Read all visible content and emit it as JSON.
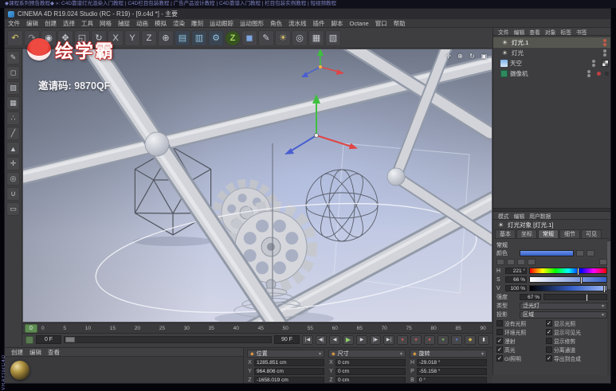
{
  "video": {
    "header": "◆课程系列预告教程◆ »: C4D靠谱灯光渲染入门教程 | C4D栏目包装教程 | 广告产品设计教程 | C4D靠谱入门教程 | 栏目包装实例教程 | 短视频教程"
  },
  "window": {
    "title": "CINEMA 4D R19.024 Studio (RC - R19) - [9.c4d *] - 主要"
  },
  "watermark": {
    "logo": "绘学霸",
    "invite": "邀请码: 9870QF"
  },
  "menubar": {
    "items": [
      "文件",
      "编辑",
      "创建",
      "选择",
      "工具",
      "网格",
      "捕捉",
      "动画",
      "模拟",
      "渲染",
      "雕刻",
      "运动跟踪",
      "运动图形",
      "角色",
      "流水线",
      "插件",
      "脚本",
      "Octane",
      "窗口",
      "帮助"
    ]
  },
  "toolbar": {
    "icons": [
      {
        "name": "undo-icon",
        "glyph": "↶"
      },
      {
        "name": "redo-icon",
        "glyph": "↷"
      },
      {
        "name": "live-selection-icon",
        "glyph": "◉"
      },
      {
        "name": "move-icon",
        "glyph": "✥"
      },
      {
        "name": "scale-icon",
        "glyph": "◱"
      },
      {
        "name": "rotate-icon",
        "glyph": "↻"
      },
      {
        "name": "x-lock-icon",
        "glyph": "X"
      },
      {
        "name": "y-lock-icon",
        "glyph": "Y"
      },
      {
        "name": "z-lock-icon",
        "glyph": "Z"
      },
      {
        "name": "coordinate-system-icon",
        "glyph": "⊕"
      },
      {
        "name": "render-view-icon",
        "glyph": "▤"
      },
      {
        "name": "render-picture-viewer-icon",
        "glyph": "▥"
      },
      {
        "name": "render-settings-icon",
        "glyph": "⚙"
      },
      {
        "name": "zdepth-plugin-icon",
        "glyph": "Z"
      },
      {
        "name": "add-cube-icon",
        "glyph": "◼"
      },
      {
        "name": "spline-pen-icon",
        "glyph": "✎"
      },
      {
        "name": "add-light-icon",
        "glyph": "☀"
      },
      {
        "name": "add-camera-icon",
        "glyph": "◎"
      },
      {
        "name": "display-mode-icon",
        "glyph": "▦"
      },
      {
        "name": "layout-icon",
        "glyph": "▧"
      }
    ]
  },
  "left_toolbar": {
    "icons": [
      {
        "name": "make-editable-icon",
        "glyph": "✎"
      },
      {
        "name": "model-mode-icon",
        "glyph": "◻"
      },
      {
        "name": "texture-mode-icon",
        "glyph": "▨"
      },
      {
        "name": "workplane-mode-icon",
        "glyph": "▦"
      },
      {
        "name": "points-mode-icon",
        "glyph": "∴"
      },
      {
        "name": "edges-mode-icon",
        "glyph": "╱"
      },
      {
        "name": "polygons-mode-icon",
        "glyph": "▲"
      },
      {
        "name": "enable-axis-icon",
        "glyph": "✛"
      },
      {
        "name": "viewport-solo-icon",
        "glyph": "◎"
      },
      {
        "name": "enable-snap-icon",
        "glyph": "∪"
      },
      {
        "name": "workplane-lock-icon",
        "glyph": "▭"
      }
    ]
  },
  "viewport": {
    "icons": [
      {
        "name": "pan-view-icon",
        "glyph": "✛"
      },
      {
        "name": "zoom-view-icon",
        "glyph": "⊕"
      },
      {
        "name": "orbit-view-icon",
        "glyph": "↻"
      },
      {
        "name": "toggle-view-icon",
        "glyph": "▣"
      }
    ]
  },
  "objects": {
    "menus": [
      "文件",
      "编辑",
      "查看",
      "对象",
      "标签",
      "书签"
    ],
    "items": [
      {
        "label": "灯光.1",
        "glyph": "☀"
      },
      {
        "label": "灯光",
        "glyph": "☀"
      },
      {
        "label": "天空",
        "glyph": ""
      },
      {
        "label": "摄像机",
        "glyph": ""
      }
    ]
  },
  "attributes": {
    "menus": [
      "模式",
      "编辑",
      "用户数据"
    ],
    "title_glyph": "☀",
    "title": "灯光对象 [灯光.1]",
    "tabs": [
      "基本",
      "坐标",
      "常规",
      "细节",
      "可见"
    ],
    "section": "常规",
    "color_label": "颜色",
    "color_hex": "#3f6fd8",
    "hsv": {
      "h_label": "H",
      "h": "221 °",
      "s_label": "S",
      "s": "66 %",
      "v_label": "V",
      "v": "100 %"
    },
    "intensity_label": "强度",
    "intensity": "67 %",
    "type_label": "类型",
    "type_value": "泛光灯",
    "shadow_label": "投影",
    "shadow_value": "区域",
    "checks": [
      {
        "left": "没有光照",
        "left_mark": "",
        "right": "显示光照",
        "right_mark": "✓"
      },
      {
        "left": "环境光照",
        "left_mark": "",
        "right": "显示可见光",
        "right_mark": "✓"
      },
      {
        "left": "漫射",
        "left_mark": "✓",
        "right": "显示修剪",
        "right_mark": ""
      },
      {
        "left": "高光",
        "left_mark": "✓",
        "right": "分离通道",
        "right_mark": ""
      },
      {
        "left": "GI照明",
        "left_mark": "✓",
        "right": "导出到合成",
        "right_mark": "✓"
      }
    ]
  },
  "timeline": {
    "current": "0",
    "ticks": [
      "0",
      "5",
      "10",
      "15",
      "20",
      "25",
      "30",
      "35",
      "40",
      "45",
      "50",
      "55",
      "60",
      "65",
      "70",
      "75",
      "80",
      "85",
      "90"
    ]
  },
  "transport": {
    "start": "0 F",
    "end": "90 F",
    "buttons": [
      {
        "name": "goto-start-icon",
        "glyph": "|◀"
      },
      {
        "name": "prev-key-icon",
        "glyph": "◀|"
      },
      {
        "name": "prev-frame-icon",
        "glyph": "◀"
      },
      {
        "name": "play-icon",
        "glyph": "▶"
      },
      {
        "name": "next-frame-icon",
        "glyph": "▶"
      },
      {
        "name": "next-key-icon",
        "glyph": "|▶"
      },
      {
        "name": "goto-end-icon",
        "glyph": "▶|"
      },
      {
        "name": "record-keyframe-icon",
        "glyph": "●"
      },
      {
        "name": "autokey-icon",
        "glyph": "●"
      },
      {
        "name": "record-position-icon",
        "glyph": "●"
      },
      {
        "name": "record-scale-icon",
        "glyph": "●"
      },
      {
        "name": "record-rotation-icon",
        "glyph": "●"
      },
      {
        "name": "record-parameter-icon",
        "glyph": "◆"
      },
      {
        "name": "record-pla-icon",
        "glyph": "▮"
      }
    ]
  },
  "materials": {
    "menus": [
      "创建",
      "编辑",
      "查看"
    ]
  },
  "coords": {
    "groups": [
      {
        "label": "位置",
        "rows": [
          {
            "axis": "X",
            "value": "1285.851 cm"
          },
          {
            "axis": "Y",
            "value": "964.806 cm"
          },
          {
            "axis": "Z",
            "value": "-1658.019 cm"
          }
        ]
      },
      {
        "label": "尺寸",
        "rows": [
          {
            "axis": "X",
            "value": "0 cm"
          },
          {
            "axis": "Y",
            "value": "0 cm"
          },
          {
            "axis": "Z",
            "value": "0 cm"
          }
        ]
      },
      {
        "label": "旋转",
        "rows": [
          {
            "axis": "H",
            "value": "-29.018 °"
          },
          {
            "axis": "P",
            "value": "-55.158 °"
          },
          {
            "axis": "B",
            "value": "0 °"
          }
        ]
      }
    ]
  },
  "vray": {
    "label": "VRAYforC4D"
  }
}
